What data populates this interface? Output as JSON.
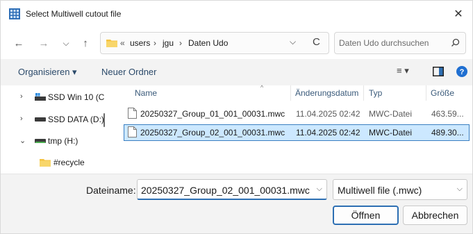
{
  "window": {
    "title": "Select Multiwell cutout file",
    "close_glyph": "✕",
    "icon": "grid-app-icon"
  },
  "nav": {
    "back_glyph": "←",
    "forward_glyph": "→",
    "recent_glyph": "⌵",
    "up_glyph": "↑",
    "overflow": "«",
    "path": [
      "users",
      "jgu",
      "Daten Udo"
    ],
    "sep": "›",
    "dropdown_glyph": "⌵",
    "refresh_glyph": "C",
    "search_placeholder": "Daten Udo durchsuchen"
  },
  "toolbar": {
    "organize_label": "Organisieren ▾",
    "new_folder_label": "Neuer Ordner",
    "view_glyph": "≡ ▾"
  },
  "sidebar": {
    "items": [
      {
        "label": "SSD Win 10  (C",
        "expander": "›",
        "icon": "drive-windows-icon"
      },
      {
        "label": "SSD DATA (D:)",
        "expander": "›",
        "icon": "drive-icon"
      },
      {
        "label": "tmp (H:)",
        "expander": "⌄",
        "icon": "drive-green-icon"
      },
      {
        "label": "#recycle",
        "expander": "",
        "icon": "folder-icon"
      }
    ]
  },
  "filelist": {
    "columns": [
      "Name",
      "Änderungsdatum",
      "Typ",
      "Größe"
    ],
    "sort_glyph": "^",
    "rows": [
      {
        "name": "20250327_Group_01_001_00031.mwc",
        "date": "11.04.2025 02:42",
        "type": "MWC-Datei",
        "size": "463.59...",
        "selected": false
      },
      {
        "name": "20250327_Group_02_001_00031.mwc",
        "date": "11.04.2025 02:42",
        "type": "MWC-Datei",
        "size": "489.30...",
        "selected": true
      }
    ]
  },
  "footer": {
    "filename_label": "Dateiname:",
    "filename_value": "20250327_Group_02_001_00031.mwc",
    "filetype_value": "Multiwell file (.mwc)",
    "open_label": "Öffnen",
    "cancel_label": "Abbrechen",
    "chevron_glyph": "⌵"
  },
  "colors": {
    "accent": "#2d6fb3",
    "selection": "#cce8ff",
    "folder": "#f5c342"
  }
}
